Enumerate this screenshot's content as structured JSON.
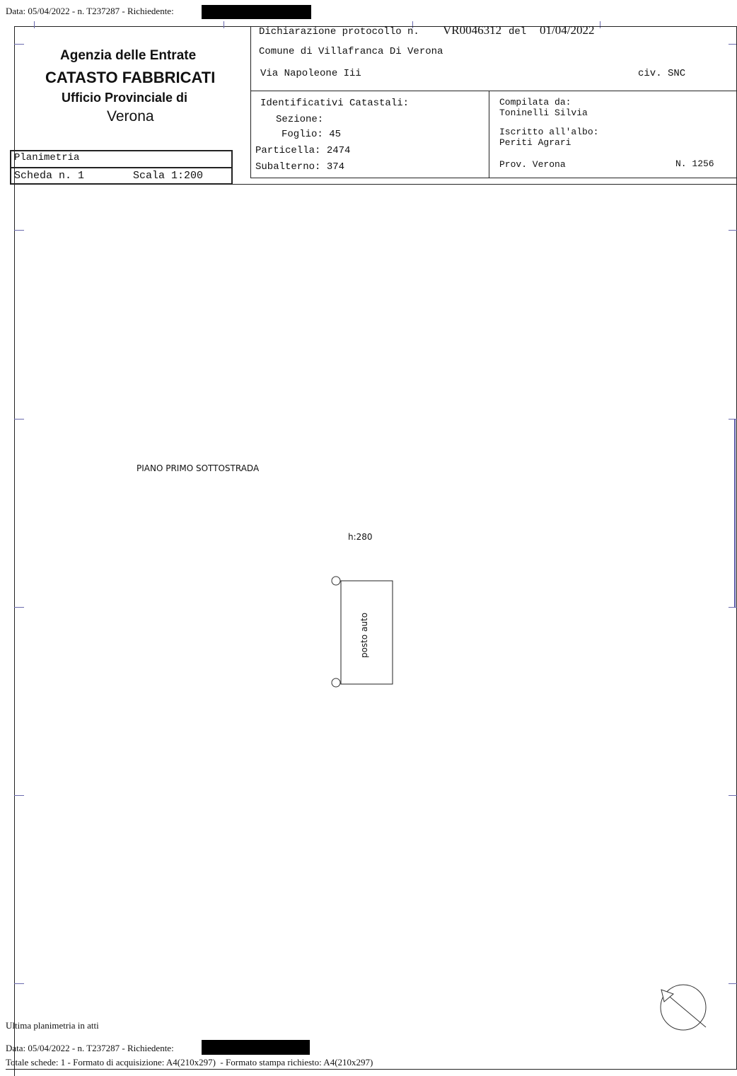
{
  "top_line": {
    "prefix": "Data: 05/04/2022 - n. T237287 - Richiedente:"
  },
  "agency": {
    "line1": "Agenzia delle Entrate",
    "line2": "CATASTO FABBRICATI",
    "line3": "Ufficio Provinciale di",
    "line4": "Verona"
  },
  "sheet": {
    "type": "Planimetria",
    "scheda": "Scheda n. 1",
    "scala": "Scala 1:200"
  },
  "declaration": {
    "label": "Dichiarazione protocollo n.",
    "number": "VR0046312",
    "del_label": "del",
    "date": "01/04/2022",
    "comune": "Comune di Villafranca Di Verona",
    "via": "Via Napoleone Iii",
    "civico": "civ. SNC"
  },
  "identifiers": {
    "title": "Identificativi Catastali:",
    "sezione": "Sezione:",
    "foglio": "Foglio: 45",
    "particella": "Particella: 2474",
    "subalterno": "Subalterno: 374"
  },
  "compiler": {
    "label": "Compilata da:",
    "name": "Toninelli Silvia",
    "albo_label": "Iscritto all'albo:",
    "albo": "Periti Agrari",
    "prov": "Prov. Verona",
    "number": "N. 1256"
  },
  "plan": {
    "floor": "PIANO PRIMO SOTTOSTRADA",
    "height": "h:280",
    "room_label": "posto auto"
  },
  "footer": {
    "ultima": "Ultima planimetria in atti",
    "data_line": "Data: 05/04/2022 - n. T237287 - Richiedente:",
    "totale": "Totale schede: 1 - Formato di acquisizione: A4(210x297)  - Formato stampa richiesto: A4(210x297)"
  }
}
